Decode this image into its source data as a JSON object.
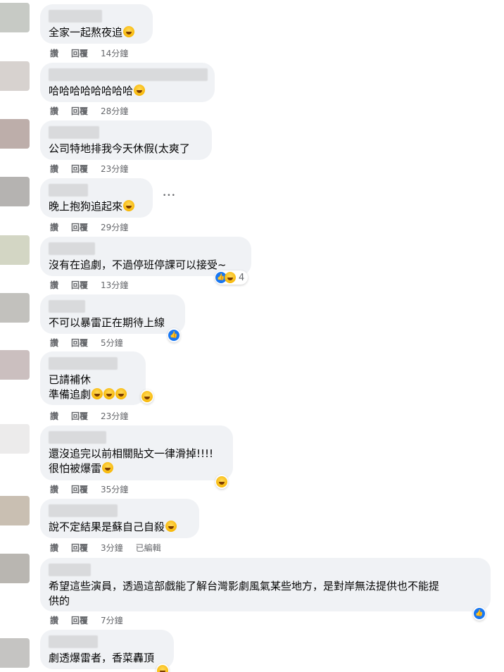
{
  "actions": {
    "like": "讚",
    "reply": "回覆",
    "edited": "已編輯",
    "more": "•••"
  },
  "comments": [
    {
      "text": "全家一起熬夜追",
      "time": "14分鐘"
    },
    {
      "text": "哈哈哈哈哈哈哈哈",
      "time": "28分鐘"
    },
    {
      "text": "公司特地排我今天休假(太爽了",
      "time": "23分鐘"
    },
    {
      "text": "晚上抱狗追起來",
      "time": "29分鐘"
    },
    {
      "text": "沒有在追劇，不過停班停課可以接受~",
      "time": "13分鐘",
      "reaction_count": "4"
    },
    {
      "text": "不可以暴雷正在期待上線",
      "time": "5分鐘"
    },
    {
      "text": "已請補休\n準備追劇",
      "time": "23分鐘"
    },
    {
      "text": "還沒追完以前相關貼文一律滑掉!!!!\n很怕被爆雷",
      "time": "35分鐘"
    },
    {
      "text": "說不定結果是蘇自己自殺",
      "time": "3分鐘"
    },
    {
      "text": "希望這些演員，透過這部戲能了解台灣影劇風氣某些地方，是對岸無法提供也不能提\n供的",
      "time": "7分鐘"
    },
    {
      "text": "劇透爆雷者，香菜轟頂"
    }
  ],
  "colors": {
    "bubble": "#f0f2f5",
    "meta": "#65676b",
    "like_blue": "#1877f2"
  }
}
